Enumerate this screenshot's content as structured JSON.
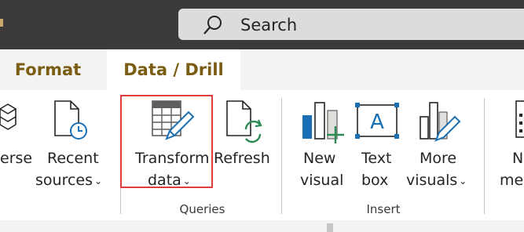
{
  "search": {
    "label": "Search"
  },
  "tabs": {
    "format": "Format",
    "data_drill": "Data / Drill"
  },
  "ribbon": {
    "buttons": {
      "dataverse": {
        "line1": "erse"
      },
      "recent_sources": {
        "line1": "Recent",
        "line2": "sources"
      },
      "transform_data": {
        "line1": "Transform",
        "line2": "data"
      },
      "refresh": {
        "line1": "Refresh"
      },
      "new_visual": {
        "line1": "New",
        "line2": "visual"
      },
      "text_box": {
        "line1": "Text",
        "line2": "box"
      },
      "more_visuals": {
        "line1": "More",
        "line2": "visuals"
      },
      "new_measure": {
        "line1": "N",
        "line2": "mea"
      }
    },
    "chevron": "⌄",
    "groups": {
      "queries": "Queries",
      "insert": "Insert"
    }
  },
  "colors": {
    "accent_tab_text": "#7a5c12",
    "highlight": "#e03c3c",
    "titlebar": "#3b3a39"
  }
}
